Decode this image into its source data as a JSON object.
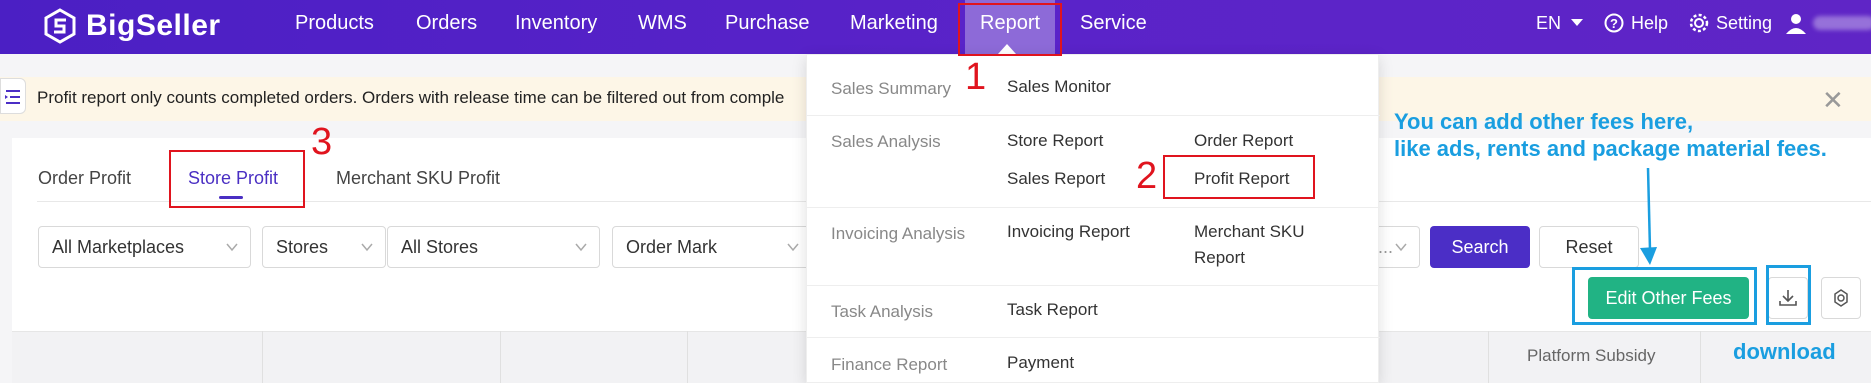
{
  "topnav": {
    "logo_text": "BigSeller",
    "items": [
      "Products",
      "Orders",
      "Inventory",
      "WMS",
      "Purchase",
      "Marketing",
      "Report",
      "Service"
    ],
    "active_item": "Report",
    "language": "EN",
    "help": "Help",
    "setting": "Setting"
  },
  "notice": {
    "text": "Profit report only counts completed orders. Orders with release time can be filtered out from comple"
  },
  "tabs": [
    "Order Profit",
    "Store Profit",
    "Merchant SKU Profit"
  ],
  "active_tab": "Store Profit",
  "filters": {
    "marketplace": "All Marketplaces",
    "stores": "Stores",
    "all_stores": "All Stores",
    "order_mark": "Order Mark",
    "truncated": "...",
    "search": "Search",
    "reset": "Reset"
  },
  "actions": {
    "edit_other_fees": "Edit Other Fees"
  },
  "table": {
    "platform_subsidy": "Platform Subsidy"
  },
  "report_menu": {
    "sections": [
      {
        "category": "Sales Summary",
        "links": [
          "Sales Monitor"
        ]
      },
      {
        "category": "Sales Analysis",
        "links": [
          "Store Report",
          "Order Report",
          "Sales Report",
          "Profit Report"
        ]
      },
      {
        "category": "Invoicing Analysis",
        "links": [
          "Invoicing Report",
          "Merchant SKU Report"
        ]
      },
      {
        "category": "Task Analysis",
        "links": [
          "Task Report"
        ]
      },
      {
        "category": "Finance Report",
        "links": [
          "Payment"
        ]
      }
    ]
  },
  "annotations": {
    "step1": "1",
    "step2": "2",
    "step3": "3",
    "fees_note_line1": "You can add other fees here,",
    "fees_note_line2": "like ads, rents and package material fees.",
    "download_label": "download"
  },
  "colors": {
    "nav_bg": "#4b1fc4",
    "primary": "#4b2ec6",
    "green": "#21b384",
    "annotation_red": "#e0141e",
    "annotation_blue": "#1a9ee0"
  }
}
